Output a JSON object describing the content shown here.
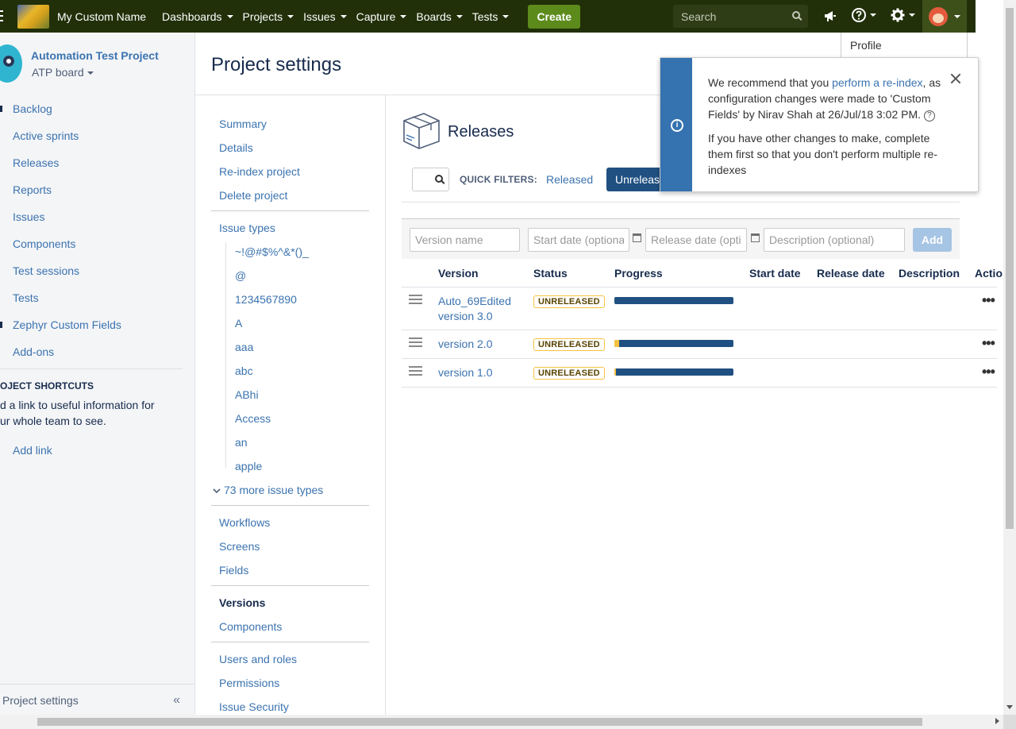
{
  "topnav": {
    "title": "My Custom Name",
    "menus": [
      "Dashboards",
      "Projects",
      "Issues",
      "Capture",
      "Boards",
      "Tests"
    ],
    "create_label": "Create",
    "search_placeholder": "Search",
    "profile_menu_item": "Profile"
  },
  "sidebar": {
    "project_name": "Automation Test Project",
    "board_name": "ATP board",
    "items": [
      "Backlog",
      "Active sprints",
      "Releases",
      "Reports",
      "Issues",
      "Components",
      "Test sessions",
      "Tests",
      "Zephyr Custom Fields",
      "Add-ons"
    ],
    "shortcuts_title": "OJECT SHORTCUTS",
    "shortcuts_desc_1": "d a link to useful information for",
    "shortcuts_desc_2": "ur whole team to see.",
    "add_link": "Add link",
    "footer_label": "Project settings",
    "collapse_glyph": "«"
  },
  "page": {
    "title": "Project settings"
  },
  "settings_nav": {
    "top_links": [
      "Summary",
      "Details",
      "Re-index project",
      "Delete project"
    ],
    "issue_types_label": "Issue types",
    "issue_types": [
      "~!@#$%^&*()_",
      "@",
      "1234567890",
      "A",
      "aaa",
      "abc",
      "ABhi",
      "Access",
      "an",
      "apple"
    ],
    "more_issue_types": "73 more issue types",
    "group2": [
      "Workflows",
      "Screens",
      "Fields"
    ],
    "versions_label": "Versions",
    "components_label": "Components",
    "group4": [
      "Users and roles",
      "Permissions",
      "Issue Security"
    ]
  },
  "releases": {
    "title": "Releases",
    "quick_filters_label": "QUICK FILTERS:",
    "filter_released": "Released",
    "filter_unreleased": "Unreleased",
    "form": {
      "version_placeholder": "Version name",
      "start_placeholder": "Start date (optional)",
      "release_placeholder": "Release date (optional)",
      "desc_placeholder": "Description (optional)",
      "add_label": "Add"
    },
    "columns": [
      "Version",
      "Status",
      "Progress",
      "Start date",
      "Release date",
      "Description",
      "Actio"
    ],
    "rows": [
      {
        "name_line1": "Auto_69Edited",
        "name_line2": "version 3.0",
        "status": "UNRELEASED",
        "warn_fraction": 0.0,
        "actions": "•••"
      },
      {
        "name_line1": "version 2.0",
        "name_line2": "",
        "status": "UNRELEASED",
        "warn_fraction": 0.04,
        "actions": "•••"
      },
      {
        "name_line1": "version 1.0",
        "name_line2": "",
        "status": "UNRELEASED",
        "warn_fraction": 0.015,
        "actions": "•••"
      }
    ]
  },
  "flag": {
    "text_before_link": "We recommend that you ",
    "link_text": "perform a re-index",
    "text_after_link": ", as configuration changes were made to 'Custom Fields' by Nirav Shah at 26/Jul/18 3:02 PM.",
    "help_glyph": "?",
    "second_paragraph": "If you have other changes to make, complete them first so that you don't perform multiple re-indexes",
    "info_glyph": "i"
  },
  "colors": {
    "nav_bg": "#213009",
    "create_green": "#5c8b1c",
    "link_blue": "#3b73af",
    "progress_blue": "#205081",
    "warn_yellow": "#f6c342"
  }
}
